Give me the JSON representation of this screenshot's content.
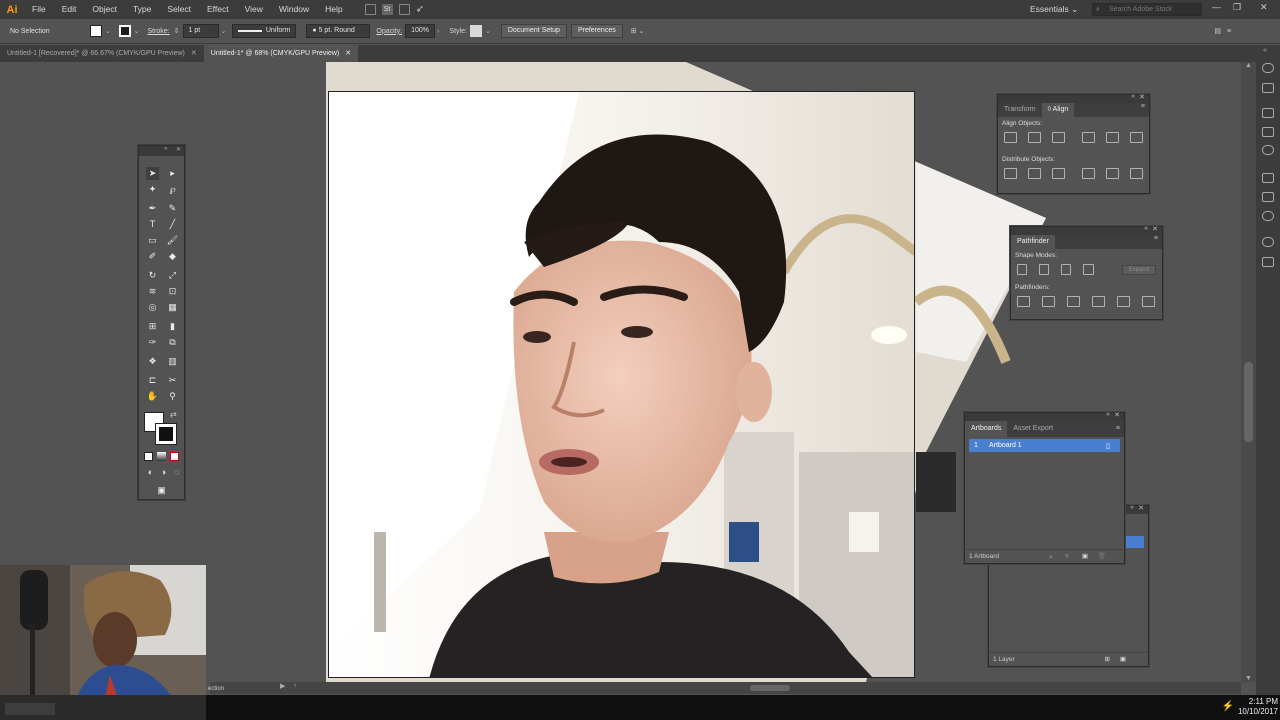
{
  "menu": {
    "logo": "Ai",
    "items": [
      "File",
      "Edit",
      "Object",
      "Type",
      "Select",
      "Effect",
      "View",
      "Window",
      "Help"
    ],
    "st_badge": "St",
    "workspace": "Essentials",
    "stock_placeholder": "Search Adobe Stock"
  },
  "control": {
    "selection": "No Selection",
    "stroke_label": "Stroke:",
    "stroke_value": "1 pt",
    "profile": "Uniform",
    "brush": "5 pt. Round",
    "opacity_label": "Opacity:",
    "opacity_value": "100%",
    "style_label": "Style:",
    "document_setup": "Document Setup",
    "preferences": "Preferences"
  },
  "tabs": [
    {
      "label": "Untitled-1 [Recovered]* @ 66.67% (CMYK/GPU Preview)",
      "active": false
    },
    {
      "label": "Untitled-1* @ 68% (CMYK/GPU Preview)",
      "active": true
    }
  ],
  "align_panel": {
    "tabs": [
      "Transform",
      "Align"
    ],
    "align_objects": "Align Objects:",
    "distribute_objects": "Distribute Objects:"
  },
  "pathfinder_panel": {
    "title": "Pathfinder",
    "shape_modes": "Shape Modes:",
    "pathfinders": "Pathfinders:",
    "expand": "Expand"
  },
  "artboards_panel": {
    "tabs": [
      "Artboards",
      "Asset Export"
    ],
    "rows": [
      {
        "num": "1",
        "name": "Artboard 1"
      }
    ],
    "footer": "1 Artboard"
  },
  "layers_panel": {
    "footer": "1 Layer"
  },
  "status": {
    "text": "ection"
  },
  "clock": {
    "time": "2:11 PM",
    "date": "10/10/2017"
  },
  "colors": {
    "accent": "#4a7ed0",
    "ai_orange": "#ff9a00"
  }
}
